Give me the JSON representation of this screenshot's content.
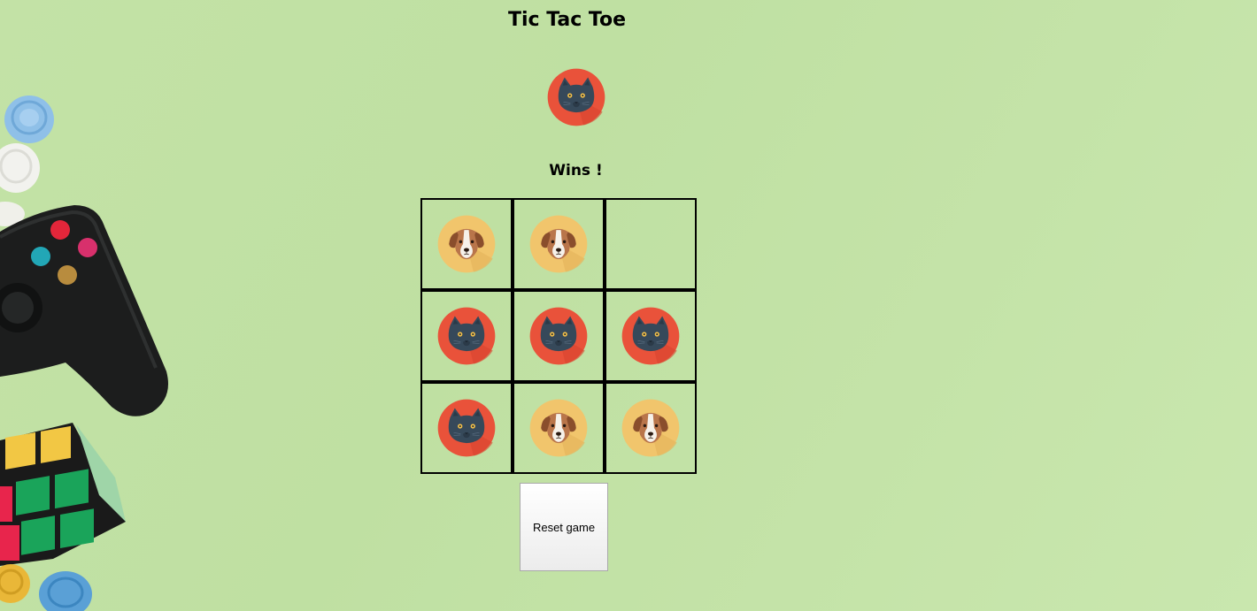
{
  "title": "Tic Tac Toe",
  "winner": {
    "piece": "cat",
    "icon": "cat-icon",
    "text": "Wins !"
  },
  "board": {
    "cells": [
      "dog",
      "dog",
      "",
      "cat",
      "cat",
      "cat",
      "cat",
      "dog",
      "dog"
    ]
  },
  "reset_label": "Reset game",
  "pieces": {
    "cat": {
      "icon": "cat-icon",
      "background": "#e9523a",
      "face": "#36495a"
    },
    "dog": {
      "icon": "dog-icon",
      "background": "#f1c56c",
      "face": "#a8653f"
    }
  }
}
